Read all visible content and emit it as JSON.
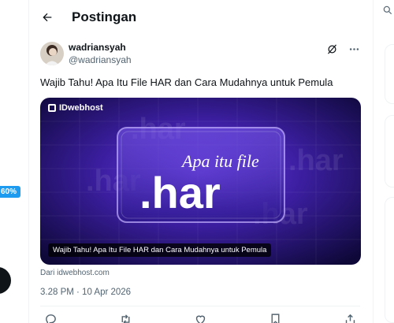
{
  "left_rail": {
    "badge": "60%"
  },
  "header": {
    "title": "Postingan"
  },
  "post": {
    "display_name": "wadriansyah",
    "handle": "@wadriansyah",
    "text": "Wajib Tahu! Apa Itu File HAR dan Cara Mudahnya untuk Pemula",
    "media": {
      "brand": "IDwebhost",
      "headline_small": "Apa itu file",
      "headline_big": ".har",
      "background_word": ".har",
      "caption": "Wajib Tahu! Apa Itu File HAR dan Cara Mudahnya untuk Pemula"
    },
    "source": "Dari idwebhost.com",
    "timestamp": "3.28 PM · 10 Apr 2026"
  },
  "colors": {
    "accent": "#1d9bf0",
    "text": "#0f1419",
    "muted": "#536471",
    "border": "#eff3f4"
  },
  "icons": {
    "back": "arrow-left-icon",
    "grok": "grok-icon",
    "more": "more-horizontal-icon",
    "reply": "reply-icon",
    "repost": "repost-icon",
    "like": "heart-icon",
    "bookmark": "bookmark-icon",
    "share": "share-icon",
    "search": "search-icon"
  }
}
